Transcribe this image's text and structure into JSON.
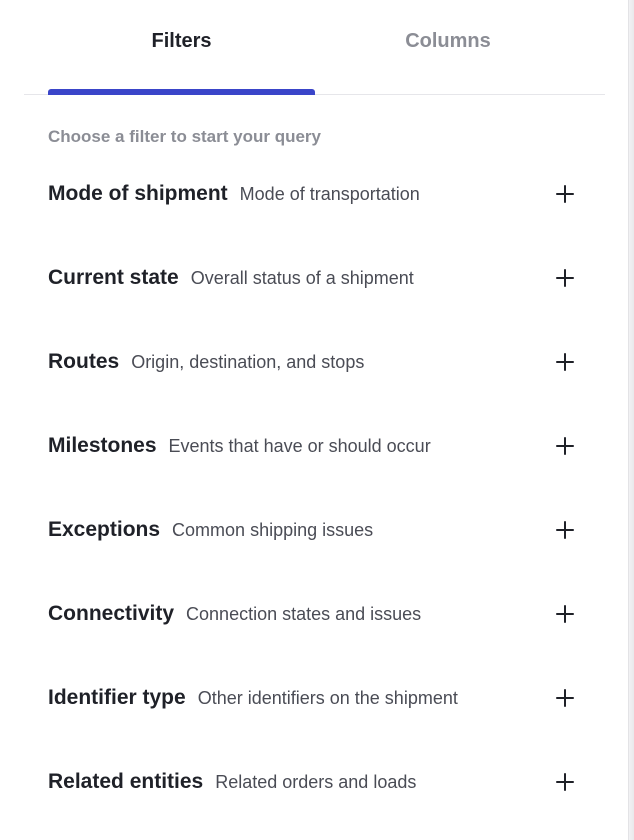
{
  "tabs": {
    "filters": "Filters",
    "columns": "Columns",
    "active": "filters"
  },
  "hint": "Choose a filter to start your query",
  "filters": [
    {
      "name": "Mode of shipment",
      "description": "Mode of transportation"
    },
    {
      "name": "Current state",
      "description": "Overall status of a shipment"
    },
    {
      "name": "Routes",
      "description": "Origin, destination, and stops"
    },
    {
      "name": "Milestones",
      "description": "Events that have or should occur"
    },
    {
      "name": "Exceptions",
      "description": "Common shipping issues"
    },
    {
      "name": "Connectivity",
      "description": "Connection states and issues"
    },
    {
      "name": "Identifier type",
      "description": "Other identifiers on the shipment"
    },
    {
      "name": "Related entities",
      "description": "Related orders and loads"
    }
  ],
  "icons": {
    "add": "plus-icon"
  },
  "colors": {
    "accent": "#3a45c9",
    "text_primary": "#1f2128",
    "text_muted": "#8b8d95",
    "text_secondary": "#4a4c55"
  }
}
